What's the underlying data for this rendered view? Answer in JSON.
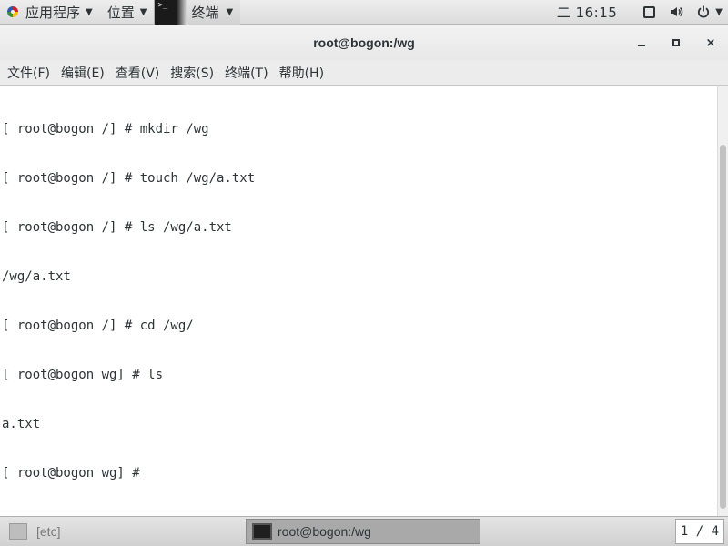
{
  "top_panel": {
    "applications_label": "应用程序",
    "places_label": "位置",
    "terminal_label": "终端",
    "terminal_icon_text": ">_",
    "clock": "二 16:15",
    "icons": [
      "apps-icon",
      "chevron-down-icon",
      "terminal-icon",
      "window-icon",
      "volume-icon",
      "power-icon"
    ]
  },
  "window": {
    "title": "root@bogon:/wg",
    "close_glyph": "×"
  },
  "menubar": {
    "items": [
      "文件(F)",
      "编辑(E)",
      "查看(V)",
      "搜索(S)",
      "终端(T)",
      "帮助(H)"
    ]
  },
  "terminal": {
    "lines": [
      "[ root@bogon /] # mkdir /wg",
      "[ root@bogon /] # touch /wg/a.txt",
      "[ root@bogon /] # ls /wg/a.txt",
      "/wg/a.txt",
      "[ root@bogon /] # cd /wg/",
      "[ root@bogon wg] # ls",
      "a.txt",
      "[ root@bogon wg] # "
    ]
  },
  "taskbar": {
    "items": [
      {
        "label": "[etc]",
        "icon": "folder-icon"
      },
      {
        "label": "root@bogon:/wg",
        "icon": "terminal-icon"
      }
    ],
    "workspace": "1 / 4"
  }
}
